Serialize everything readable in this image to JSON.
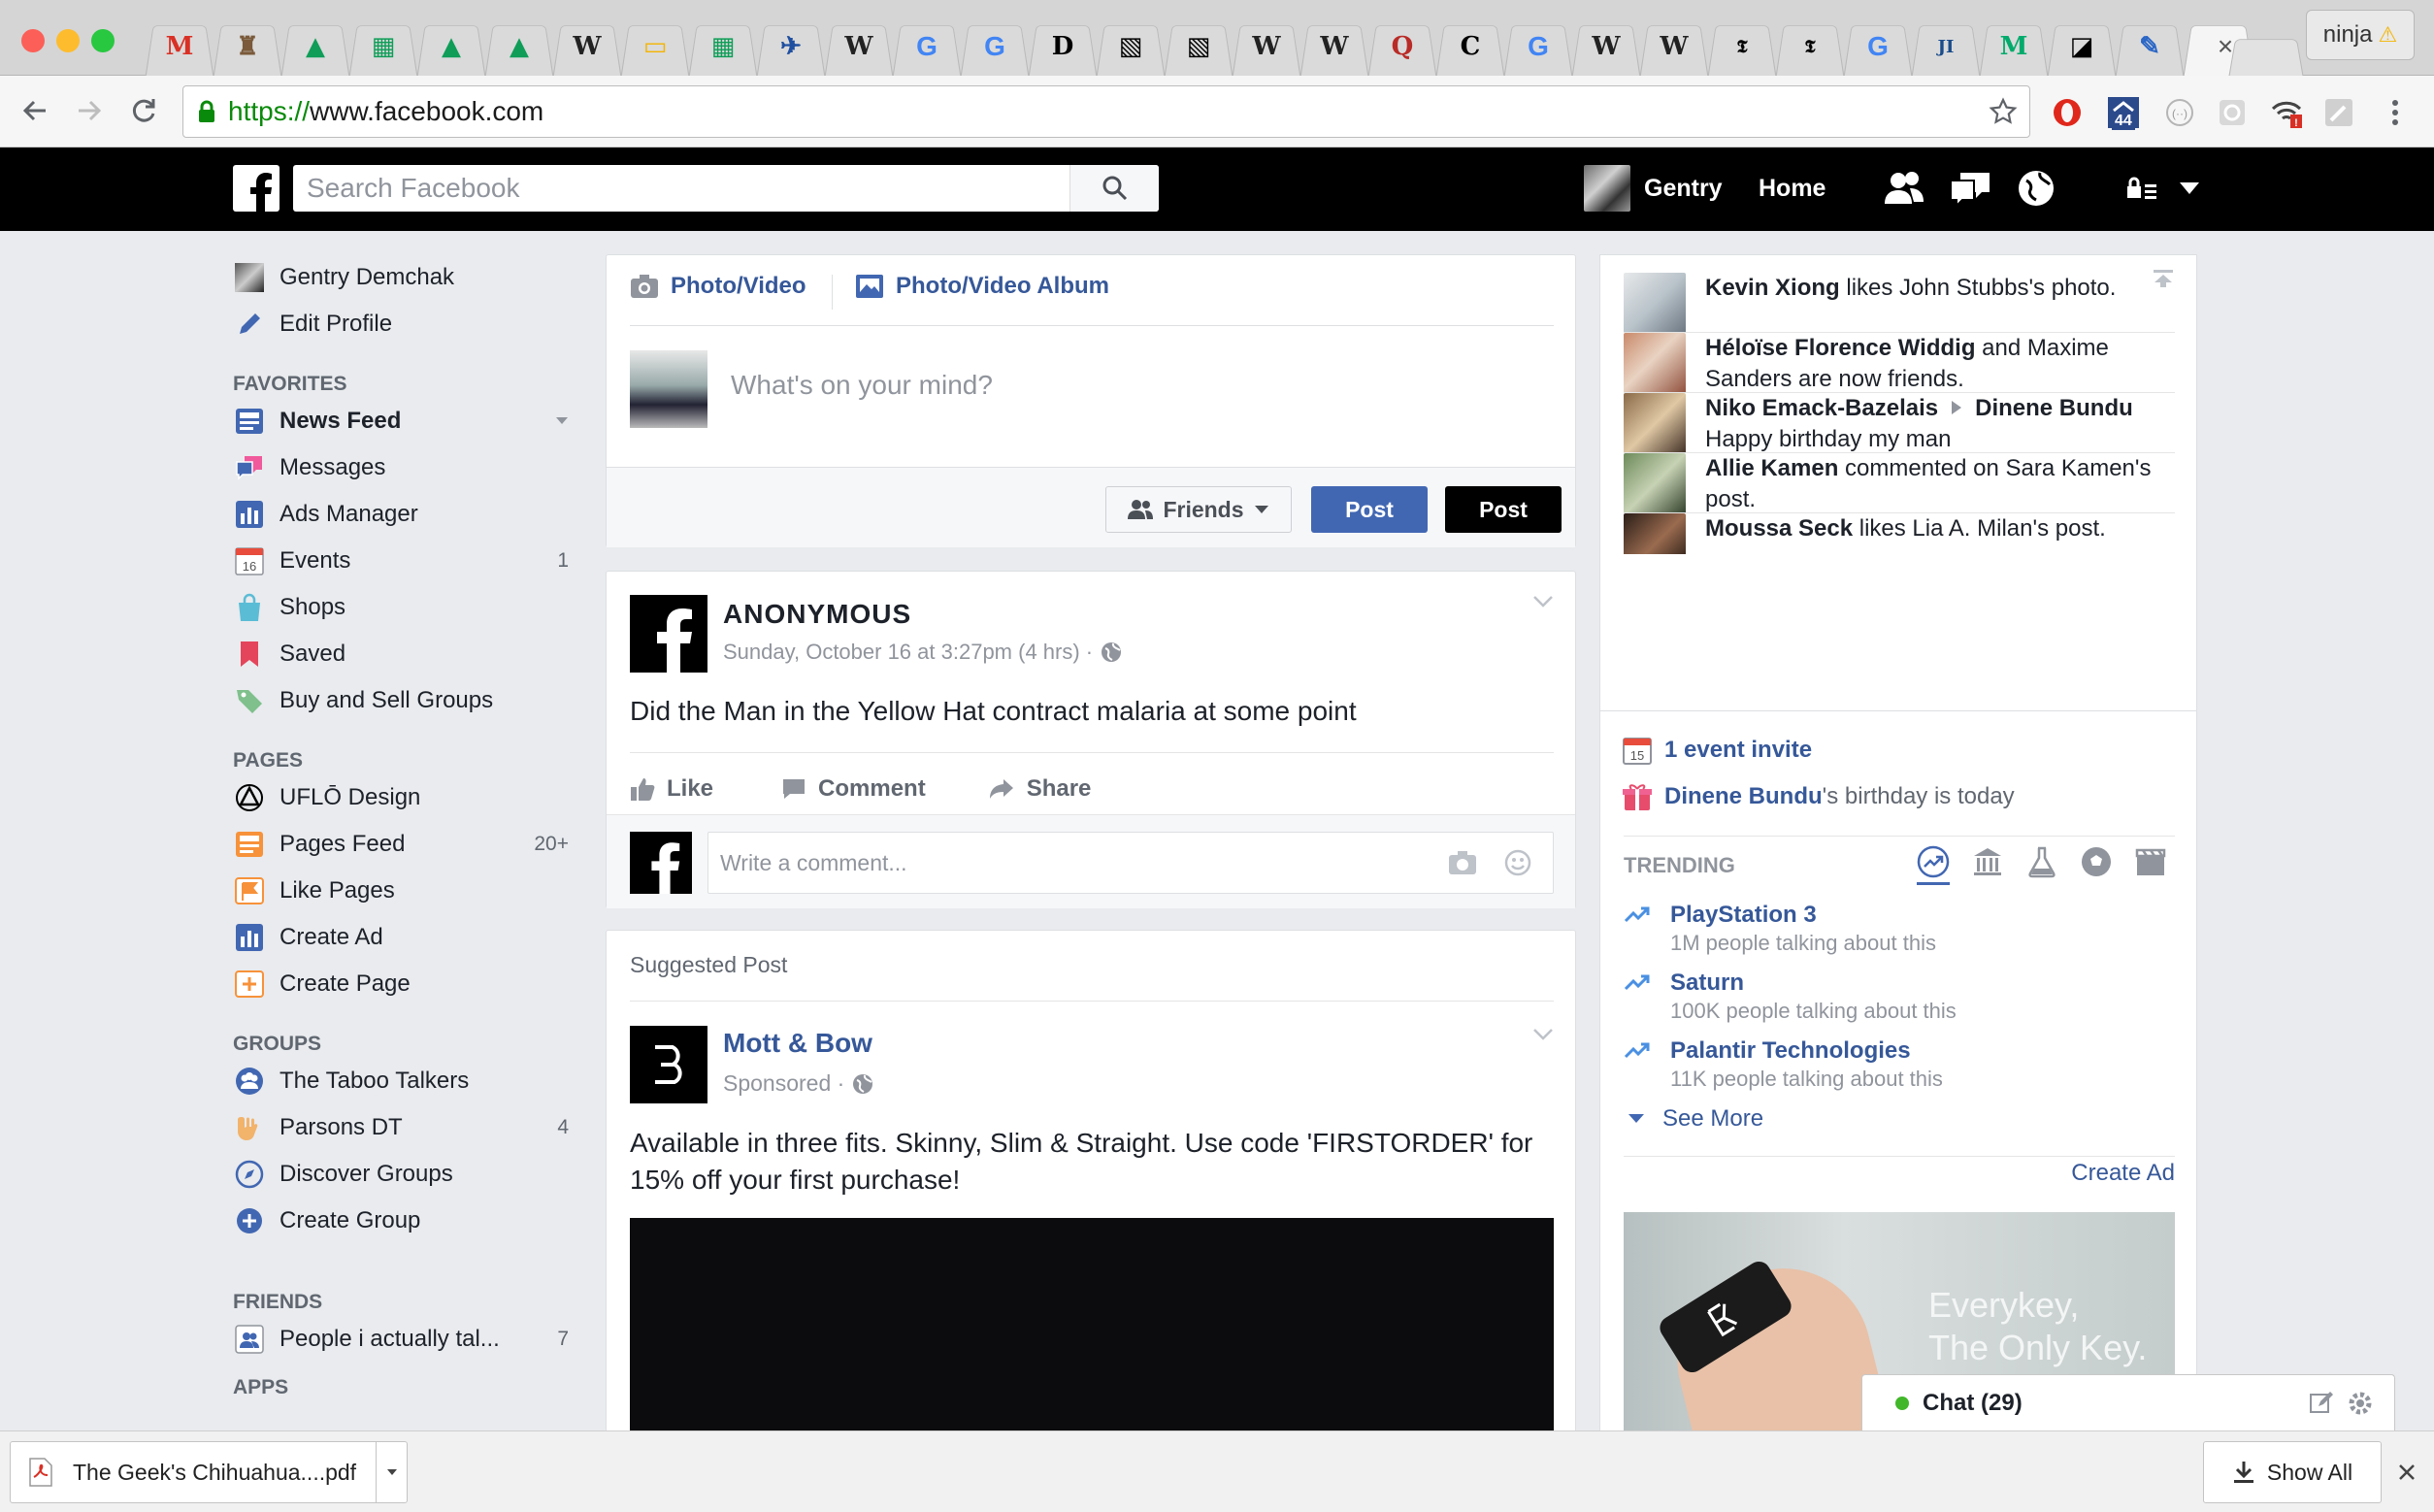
{
  "browser": {
    "tabs": [
      {
        "icon": "gmail-icon",
        "glyph": "M",
        "color": "#d93025"
      },
      {
        "icon": "castle-icon",
        "glyph": "♜",
        "color": "#7a5a3a"
      },
      {
        "icon": "google-drive-icon",
        "glyph": "▲",
        "color": "#0f9d58"
      },
      {
        "icon": "google-sheets-icon",
        "glyph": "▦",
        "color": "#0f9d58"
      },
      {
        "icon": "google-drive-icon",
        "glyph": "▲",
        "color": "#0f9d58"
      },
      {
        "icon": "google-drive-icon",
        "glyph": "▲",
        "color": "#0f9d58"
      },
      {
        "icon": "wikipedia-icon",
        "glyph": "W",
        "color": "#222222"
      },
      {
        "icon": "google-slides-icon",
        "glyph": "▭",
        "color": "#f4b400"
      },
      {
        "icon": "google-sheets-icon",
        "glyph": "▦",
        "color": "#0f9d58"
      },
      {
        "icon": "bird-logo-icon",
        "glyph": "✈",
        "color": "#1f4fa0"
      },
      {
        "icon": "wikipedia-icon",
        "glyph": "W",
        "color": "#222222"
      },
      {
        "icon": "google-icon",
        "glyph": "G",
        "color": "#4285f4"
      },
      {
        "icon": "google-icon",
        "glyph": "G",
        "color": "#4285f4"
      },
      {
        "icon": "d-logo-icon",
        "glyph": "D",
        "color": "#000000"
      },
      {
        "icon": "stripes-icon",
        "glyph": "▧",
        "color": "#000000"
      },
      {
        "icon": "stripes-icon",
        "glyph": "▧",
        "color": "#000000"
      },
      {
        "icon": "wikipedia-icon",
        "glyph": "W",
        "color": "#222222"
      },
      {
        "icon": "wikipedia-icon",
        "glyph": "W",
        "color": "#222222"
      },
      {
        "icon": "quora-icon",
        "glyph": "Q",
        "color": "#b92b27"
      },
      {
        "icon": "c-logo-icon",
        "glyph": "C",
        "color": "#000000"
      },
      {
        "icon": "google-icon",
        "glyph": "G",
        "color": "#4285f4"
      },
      {
        "icon": "wikipedia-icon",
        "glyph": "W",
        "color": "#222222"
      },
      {
        "icon": "wikipedia-icon",
        "glyph": "W",
        "color": "#222222"
      },
      {
        "icon": "nytimes-icon",
        "glyph": "𝕿",
        "color": "#000000"
      },
      {
        "icon": "nytimes-icon",
        "glyph": "𝕿",
        "color": "#000000"
      },
      {
        "icon": "google-icon",
        "glyph": "G",
        "color": "#4285f4"
      },
      {
        "icon": "joi-ito-icon",
        "glyph": "JI",
        "color": "#1a4c8a"
      },
      {
        "icon": "medium-icon",
        "glyph": "M",
        "color": "#00ab6c"
      },
      {
        "icon": "square-logo-icon",
        "glyph": "◪",
        "color": "#000000"
      },
      {
        "icon": "tools-icon",
        "glyph": "✎",
        "color": "#2a66c6"
      }
    ],
    "profile_name": "ninja",
    "warning_glyph": "⚠",
    "url_scheme": "https://",
    "url_host": "www.facebook.com",
    "extension_badge": "44"
  },
  "fb_header": {
    "search_placeholder": "Search Facebook",
    "user_name": "Gentry",
    "home_label": "Home"
  },
  "leftnav": {
    "profile": {
      "name": "Gentry Demchak",
      "edit": "Edit Profile"
    },
    "favorites_title": "FAVORITES",
    "favorites": [
      {
        "label": "News Feed",
        "icon": "news-feed-icon",
        "count": "",
        "bold": true
      },
      {
        "label": "Messages",
        "icon": "messages-icon",
        "count": ""
      },
      {
        "label": "Ads Manager",
        "icon": "ads-manager-icon",
        "count": ""
      },
      {
        "label": "Events",
        "icon": "events-icon",
        "count": "1"
      },
      {
        "label": "Shops",
        "icon": "shops-icon",
        "count": ""
      },
      {
        "label": "Saved",
        "icon": "saved-icon",
        "count": ""
      },
      {
        "label": "Buy and Sell Groups",
        "icon": "buy-sell-icon",
        "count": ""
      }
    ],
    "pages_title": "PAGES",
    "pages": [
      {
        "label": "UFLŌ Design",
        "icon": "uflo-icon",
        "count": ""
      },
      {
        "label": "Pages Feed",
        "icon": "pages-feed-icon",
        "count": "20+"
      },
      {
        "label": "Like Pages",
        "icon": "like-pages-icon",
        "count": ""
      },
      {
        "label": "Create Ad",
        "icon": "create-ad-icon",
        "count": ""
      },
      {
        "label": "Create Page",
        "icon": "create-page-icon",
        "count": ""
      }
    ],
    "groups_title": "GROUPS",
    "groups": [
      {
        "label": "The Taboo Talkers",
        "icon": "group-icon",
        "count": ""
      },
      {
        "label": "Parsons DT",
        "icon": "rock-hand-icon",
        "count": "4"
      },
      {
        "label": "Discover Groups",
        "icon": "compass-icon",
        "count": ""
      },
      {
        "label": "Create Group",
        "icon": "plus-circle-icon",
        "count": ""
      }
    ],
    "friends_title": "FRIENDS",
    "friends": [
      {
        "label": "People i actually tal...",
        "icon": "friend-list-icon",
        "count": "7"
      }
    ],
    "apps_title": "APPS"
  },
  "composer": {
    "tab_photo": "Photo/Video",
    "tab_album": "Photo/Video Album",
    "placeholder": "What's on your mind?",
    "audience": "Friends",
    "post_blue": "Post",
    "post_black": "Post"
  },
  "story": {
    "author": "ANONYMOUS",
    "time": "Sunday, October 16 at 3:27pm (4 hrs) ·",
    "text": "Did the Man in the Yellow Hat contract malaria at some point",
    "like": "Like",
    "comment": "Comment",
    "share": "Share",
    "comment_placeholder": "Write a comment..."
  },
  "suggested": {
    "header": "Suggested Post",
    "author": "Mott & Bow",
    "sponsored": "Sponsored ·",
    "text": "Available in three fits. Skinny, Slim & Straight. Use code 'FIRSTORDER' for 15% off your first purchase!"
  },
  "ticker": [
    {
      "bold": "Kevin Xiong",
      "rest": " likes John Stubbs's photo.",
      "line2": ""
    },
    {
      "bold": "Héloïse Florence Widdig",
      "rest": " and Maxime",
      "line2": "Sanders are now friends."
    },
    {
      "bold": "Niko Emack-Bazelais",
      "rest": "",
      "bold2": "Dinene Bundu",
      "line2": "Happy birthday my man"
    },
    {
      "bold": "Allie Kamen",
      "rest": " commented on Sara Kamen's",
      "line2": "post."
    },
    {
      "bold": "Moussa Seck",
      "rest": " likes Lia A. Milan's post.",
      "line2": ""
    }
  ],
  "reminders": {
    "event_invite": "1 event invite",
    "birthday_name": "Dinene Bundu",
    "birthday_rest": "'s birthday is today"
  },
  "trending": {
    "title": "TRENDING",
    "items": [
      {
        "title": "PlayStation 3",
        "sub": "1M people talking about this"
      },
      {
        "title": "Saturn",
        "sub": "100K people talking about this"
      },
      {
        "title": "Palantir Technologies",
        "sub": "11K people talking about this"
      }
    ],
    "see_more": "See More"
  },
  "ad": {
    "create_ad": "Create Ad",
    "headline1": "Everykey,",
    "headline2": "The Only Key."
  },
  "chat": {
    "label": "Chat (29)"
  },
  "downloads": {
    "file": "The Geek's Chihuahua....pdf",
    "show_all": "Show All"
  },
  "colors": {
    "fb_blue": "#4267b2",
    "link_blue": "#365899",
    "header_black": "#000000",
    "online_green": "#42b72a"
  }
}
